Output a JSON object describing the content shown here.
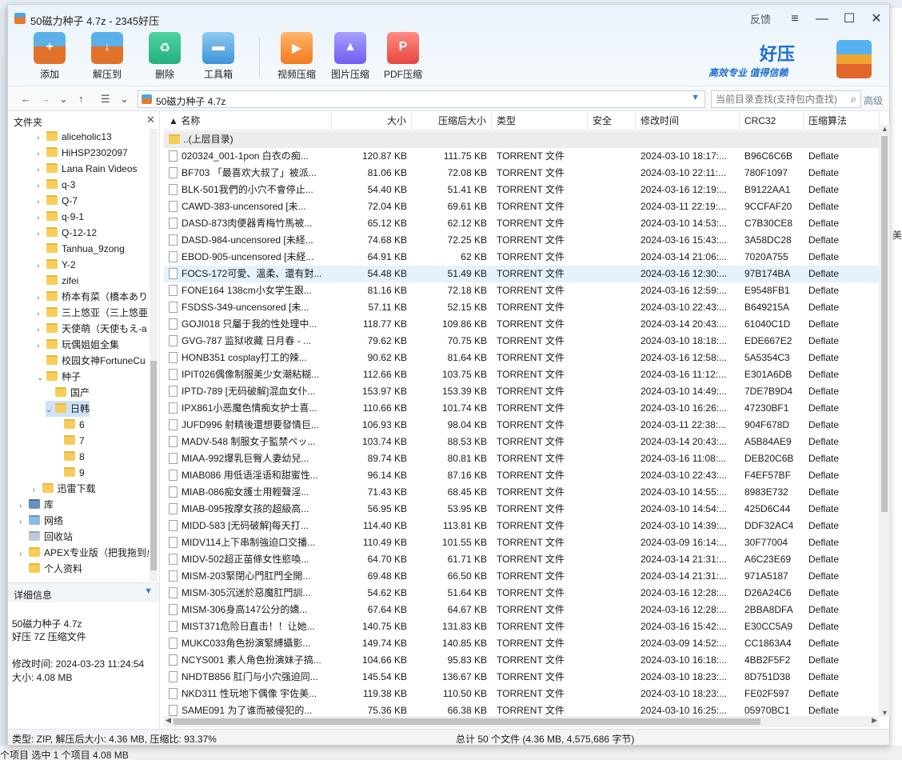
{
  "background": {
    "bottom_text": "个项目    选中 1 个项目  4.08 MB",
    "right_text": "美"
  },
  "window": {
    "title": "50磁力种子 4.7z - 2345好压",
    "feedback": "反馈",
    "controls": [
      "≡",
      "—",
      "☐",
      "✕"
    ]
  },
  "toolbar": {
    "tools": [
      {
        "label": "添加",
        "icon": "add-archive-icon"
      },
      {
        "label": "解压到",
        "icon": "extract-icon"
      },
      {
        "label": "删除",
        "icon": "recycle-icon"
      },
      {
        "label": "工具箱",
        "icon": "toolbox-icon"
      },
      {
        "label": "视频压缩",
        "icon": "video-compress-icon"
      },
      {
        "label": "图片压缩",
        "icon": "image-compress-icon"
      },
      {
        "label": "PDF压缩",
        "icon": "pdf-compress-icon"
      }
    ]
  },
  "brand": {
    "name": "好压",
    "slogan": "高效专业  值得信赖"
  },
  "address": {
    "path": "50磁力种子 4.7z",
    "search_placeholder": "当前目录查找(支持包内查找)",
    "advanced": "高级"
  },
  "tree": {
    "title": "文件夹",
    "items": [
      {
        "label": "aliceholic13",
        "arrow": "›",
        "indent": 0,
        "icon": "folder"
      },
      {
        "label": "HiHSP2302097",
        "arrow": "›",
        "indent": 0,
        "icon": "folder"
      },
      {
        "label": "Lana Rain Videos",
        "arrow": "›",
        "indent": 0,
        "icon": "folder"
      },
      {
        "label": "q-3",
        "arrow": "›",
        "indent": 0,
        "icon": "folder"
      },
      {
        "label": "Q-7",
        "arrow": "›",
        "indent": 0,
        "icon": "folder"
      },
      {
        "label": "q-9-1",
        "arrow": "›",
        "indent": 0,
        "icon": "folder"
      },
      {
        "label": "Q-12-12",
        "arrow": "›",
        "indent": 0,
        "icon": "folder"
      },
      {
        "label": "Tanhua_9zong",
        "arrow": "",
        "indent": 0,
        "icon": "folder"
      },
      {
        "label": "Y-2",
        "arrow": "›",
        "indent": 0,
        "icon": "folder"
      },
      {
        "label": "zifei",
        "arrow": "",
        "indent": 0,
        "icon": "folder"
      },
      {
        "label": "桥本有菜（橋本ありな",
        "arrow": "›",
        "indent": 0,
        "icon": "folder"
      },
      {
        "label": "三上悠亚（三上悠亜",
        "arrow": "›",
        "indent": 0,
        "icon": "folder"
      },
      {
        "label": "天使萌（天使もえ-a",
        "arrow": "›",
        "indent": 0,
        "icon": "folder"
      },
      {
        "label": "玩偶姐姐全集",
        "arrow": "›",
        "indent": 0,
        "icon": "folder"
      },
      {
        "label": "校园女神FortuneCu",
        "arrow": "",
        "indent": 0,
        "icon": "folder"
      },
      {
        "label": "种子",
        "arrow": "⌄",
        "indent": 0,
        "icon": "folder"
      },
      {
        "label": "国产",
        "arrow": "",
        "indent": 1,
        "icon": "folder"
      },
      {
        "label": "日韩",
        "arrow": "⌄",
        "indent": 1,
        "icon": "folder",
        "selected": true
      },
      {
        "label": "6",
        "arrow": "",
        "indent": 2,
        "icon": "folder"
      },
      {
        "label": "7",
        "arrow": "",
        "indent": 2,
        "icon": "folder"
      },
      {
        "label": "8",
        "arrow": "",
        "indent": 2,
        "icon": "folder"
      },
      {
        "label": "9",
        "arrow": "",
        "indent": 2,
        "icon": "folder"
      },
      {
        "label": "迅雷下载",
        "arrow": "›",
        "indent": -0.5,
        "icon": "folder"
      },
      {
        "label": "库",
        "arrow": "›",
        "indent": -2,
        "icon": "lib"
      },
      {
        "label": "网络",
        "arrow": "›",
        "indent": -2,
        "icon": "net"
      },
      {
        "label": "回收站",
        "arrow": "",
        "indent": -2,
        "icon": "bin"
      },
      {
        "label": "APEX专业版（把我拖到桌",
        "arrow": "›",
        "indent": -2,
        "icon": "folder"
      },
      {
        "label": "个人资料",
        "arrow": "",
        "indent": -2,
        "icon": "folder"
      }
    ]
  },
  "details": {
    "title": "详细信息",
    "name": "50磁力种子 4.7z",
    "type": "好压 7Z 压缩文件",
    "modified": "修改时间:  2024-03-23 11:24:54",
    "size": "大小:  4.08 MB"
  },
  "list": {
    "headers": [
      "▲ 名称",
      "大小",
      "压缩后大小",
      "类型",
      "安全",
      "修改时间",
      "CRC32",
      "压缩算法"
    ],
    "up_label": "..(上层目录)",
    "rows": [
      [
        "020324_001-1pon 白衣の痴...",
        "120.87 KB",
        "111.75 KB",
        "TORRENT 文件",
        "",
        "2024-03-10 18:17:...",
        "B96C6C6B",
        "Deflate"
      ],
      [
        "BF703 「最喜欢大叔了」被派...",
        "81.06 KB",
        "72.08 KB",
        "TORRENT 文件",
        "",
        "2024-03-10 22:11:...",
        "780F1097",
        "Deflate"
      ],
      [
        "BLK-501我們的小穴不會停止...",
        "54.40 KB",
        "51.41 KB",
        "TORRENT 文件",
        "",
        "2024-03-16 12:19:...",
        "B9122AA1",
        "Deflate"
      ],
      [
        "CAWD-383-uncensored [未...",
        "72.04 KB",
        "69.61 KB",
        "TORRENT 文件",
        "",
        "2024-03-11 22:19:...",
        "9CCFAF20",
        "Deflate"
      ],
      [
        "DASD-873肉便器青梅竹馬被...",
        "65.12 KB",
        "62.12 KB",
        "TORRENT 文件",
        "",
        "2024-03-10 14:53:...",
        "C7B30CE8",
        "Deflate"
      ],
      [
        "DASD-984-uncensored [未経...",
        "74.68 KB",
        "72.25 KB",
        "TORRENT 文件",
        "",
        "2024-03-16 15:43:...",
        "3A58DC28",
        "Deflate"
      ],
      [
        "EBOD-905-uncensored [未経...",
        "64.91 KB",
        "62 KB",
        "TORRENT 文件",
        "",
        "2024-03-14 21:06:...",
        "7020A755",
        "Deflate"
      ],
      [
        "FOCS-172可愛、溫柔、還有對...",
        "54.48 KB",
        "51.49 KB",
        "TORRENT 文件",
        "",
        "2024-03-16 12:30:...",
        "97B174BA",
        "Deflate"
      ],
      [
        "FONE164 138cm小女学生跟...",
        "81.16 KB",
        "72.18 KB",
        "TORRENT 文件",
        "",
        "2024-03-16 12:59:...",
        "E9548FB1",
        "Deflate"
      ],
      [
        "FSDSS-349-uncensored [未...",
        "57.11 KB",
        "52.15 KB",
        "TORRENT 文件",
        "",
        "2024-03-10 22:43:...",
        "B649215A",
        "Deflate"
      ],
      [
        "GOJI018 只屬于我的性处理中...",
        "118.77 KB",
        "109.86 KB",
        "TORRENT 文件",
        "",
        "2024-03-14 20:43:...",
        "61040C1D",
        "Deflate"
      ],
      [
        "GVG-787 监狱收藏 日月春 - ...",
        "79.62 KB",
        "70.75 KB",
        "TORRENT 文件",
        "",
        "2024-03-10 18:18:...",
        "EDE667E2",
        "Deflate"
      ],
      [
        "HONB351 cosplay打工的辣...",
        "90.62 KB",
        "81.64 KB",
        "TORRENT 文件",
        "",
        "2024-03-16 12:58:...",
        "5A5354C3",
        "Deflate"
      ],
      [
        "IPIT026偶像制服美少女潮粘糊...",
        "112.66 KB",
        "103.75 KB",
        "TORRENT 文件",
        "",
        "2024-03-16 11:12:...",
        "E301A6DB",
        "Deflate"
      ],
      [
        "IPTD-789 [无码破解]混血女仆...",
        "153.97 KB",
        "153.39 KB",
        "TORRENT 文件",
        "",
        "2024-03-10 14:49:...",
        "7DE7B9D4",
        "Deflate"
      ],
      [
        "IPX861小恶魔色情痴女护士喜...",
        "110.66 KB",
        "101.74 KB",
        "TORRENT 文件",
        "",
        "2024-03-10 16:26:...",
        "47230BF1",
        "Deflate"
      ],
      [
        "JUFD996 射精後還想要發情巨...",
        "106.93 KB",
        "98.04 KB",
        "TORRENT 文件",
        "",
        "2024-03-11 22:38:...",
        "904F678D",
        "Deflate"
      ],
      [
        "MADV-548 制服女子監禁ペッ...",
        "103.74 KB",
        "88.53 KB",
        "TORRENT 文件",
        "",
        "2024-03-14 20:43:...",
        "A5B84AE9",
        "Deflate"
      ],
      [
        "MIAA-992爆乳巨臀人妻幼兒...",
        "89.74 KB",
        "80.81 KB",
        "TORRENT 文件",
        "",
        "2024-03-16 11:08:...",
        "DEB20C6B",
        "Deflate"
      ],
      [
        "MIAB086 用低语淫语和甜蜜性...",
        "96.14 KB",
        "87.16 KB",
        "TORRENT 文件",
        "",
        "2024-03-10 22:43:...",
        "F4EF57BF",
        "Deflate"
      ],
      [
        "MIAB-086痴女護士用輕聲淫...",
        "71.43 KB",
        "68.45 KB",
        "TORRENT 文件",
        "",
        "2024-03-10 14:55:...",
        "8983E732",
        "Deflate"
      ],
      [
        "MIAB-095按摩女孩的超級高...",
        "56.95 KB",
        "53.95 KB",
        "TORRENT 文件",
        "",
        "2024-03-10 14:54:...",
        "425D6C44",
        "Deflate"
      ],
      [
        "MIDD-583 [无码破解]每天打...",
        "114.40 KB",
        "113.81 KB",
        "TORRENT 文件",
        "",
        "2024-03-10 14:39:...",
        "DDF32AC4",
        "Deflate"
      ],
      [
        "MIDV114上下串制強迫口交播...",
        "110.49 KB",
        "101.55 KB",
        "TORRENT 文件",
        "",
        "2024-03-09 16:14:...",
        "30F77004",
        "Deflate"
      ],
      [
        "MIDV-502超正苗條女性慾喚...",
        "64.70 KB",
        "61.71 KB",
        "TORRENT 文件",
        "",
        "2024-03-14 21:31:...",
        "A6C23E69",
        "Deflate"
      ],
      [
        "MISM-203緊閉心門肛門全開...",
        "69.48 KB",
        "66.50 KB",
        "TORRENT 文件",
        "",
        "2024-03-14 21:31:...",
        "971A5187",
        "Deflate"
      ],
      [
        "MISM-305沉迷於惡魔肛門訓...",
        "54.62 KB",
        "51.64 KB",
        "TORRENT 文件",
        "",
        "2024-03-16 12:28:...",
        "D26A24C6",
        "Deflate"
      ],
      [
        "MISM-306身高147公分的嬌...",
        "67.64 KB",
        "64.67 KB",
        "TORRENT 文件",
        "",
        "2024-03-16 12:28:...",
        "2BBA8DFA",
        "Deflate"
      ],
      [
        "MIST371危险日直击！！让她...",
        "140.75 KB",
        "131.83 KB",
        "TORRENT 文件",
        "",
        "2024-03-16 15:42:...",
        "E30CC5A9",
        "Deflate"
      ],
      [
        "MUKC033角色扮演緊縛攝影...",
        "149.74 KB",
        "140.85 KB",
        "TORRENT 文件",
        "",
        "2024-03-09 14:52:...",
        "CC1863A4",
        "Deflate"
      ],
      [
        "NCYS001 素人角色扮演妹子搞...",
        "104.66 KB",
        "95.83 KB",
        "TORRENT 文件",
        "",
        "2024-03-10 16:18:...",
        "4BB2F5F2",
        "Deflate"
      ],
      [
        "NHDTB856 肛门与小穴强迫同...",
        "145.54 KB",
        "136.67 KB",
        "TORRENT 文件",
        "",
        "2024-03-10 18:23:...",
        "8D751D38",
        "Deflate"
      ],
      [
        "NKD311 性玩地下偶像 宇佐美...",
        "119.38 KB",
        "110.50 KB",
        "TORRENT 文件",
        "",
        "2024-03-10 18:23:...",
        "FE02F597",
        "Deflate"
      ],
      [
        "SAME091 为了谁而被侵犯的...",
        "75.36 KB",
        "66.38 KB",
        "TORRENT 文件",
        "",
        "2024-03-10 16:25:...",
        "05970BC1",
        "Deflate"
      ]
    ],
    "selected_row": 7
  },
  "status": {
    "left": "类型: ZIP, 解压后大小: 4.36 MB, 压缩比: 93.37%",
    "right": "总计 50 个文件 (4.36 MB, 4,575,686 字节)"
  }
}
